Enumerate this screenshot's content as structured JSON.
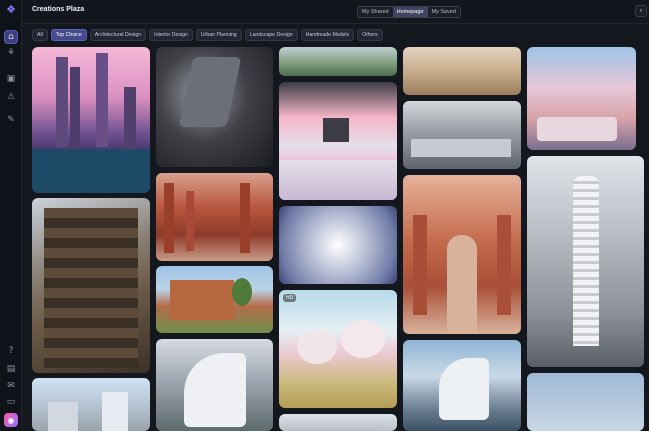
{
  "app": {
    "title": "Creations Plaza"
  },
  "header": {
    "views": [
      {
        "label": "My Shared",
        "active": false
      },
      {
        "label": "Homepage",
        "active": true
      },
      {
        "label": "My Saved",
        "active": false
      }
    ],
    "right_icon": "search-icon"
  },
  "filters": [
    {
      "label": "All",
      "active": false
    },
    {
      "label": "Top Choice",
      "active": true
    },
    {
      "label": "Architectural Design",
      "active": false
    },
    {
      "label": "Interior Design",
      "active": false
    },
    {
      "label": "Urban Planning",
      "active": false
    },
    {
      "label": "Landscape Design",
      "active": false
    },
    {
      "label": "Handmade Models",
      "active": false
    },
    {
      "label": "Others",
      "active": false
    }
  ],
  "sidebar": {
    "logo_icon": "app-logo-icon",
    "top_icons": [
      "home-icon",
      "network-icon",
      "image-icon",
      "warning-icon",
      "brush-icon"
    ],
    "active_icon": "home-icon",
    "bottom_icons": [
      "help-icon",
      "document-icon",
      "mail-icon",
      "chat-icon"
    ],
    "app_icon": "app-switch-icon"
  },
  "gallery": {
    "cards": [
      {
        "id": "c1a",
        "label": ""
      },
      {
        "id": "c1b",
        "label": ""
      },
      {
        "id": "c1c",
        "label": ""
      },
      {
        "id": "c2a",
        "label": ""
      },
      {
        "id": "c2b",
        "label": ""
      },
      {
        "id": "c2c",
        "label": ""
      },
      {
        "id": "c2d",
        "label": ""
      },
      {
        "id": "c3a",
        "label": ""
      },
      {
        "id": "c3b",
        "label": ""
      },
      {
        "id": "c3c",
        "label": ""
      },
      {
        "id": "c3d",
        "label": "HD"
      },
      {
        "id": "c3e",
        "label": ""
      },
      {
        "id": "c4a",
        "label": ""
      },
      {
        "id": "c4b",
        "label": ""
      },
      {
        "id": "c4c",
        "label": ""
      },
      {
        "id": "c4d",
        "label": ""
      },
      {
        "id": "c5a",
        "label": ""
      },
      {
        "id": "c5b",
        "label": ""
      },
      {
        "id": "c5c",
        "label": ""
      }
    ]
  },
  "colors": {
    "background": "#15171f",
    "accent": "#454a8f",
    "sidebar": "#101219"
  }
}
